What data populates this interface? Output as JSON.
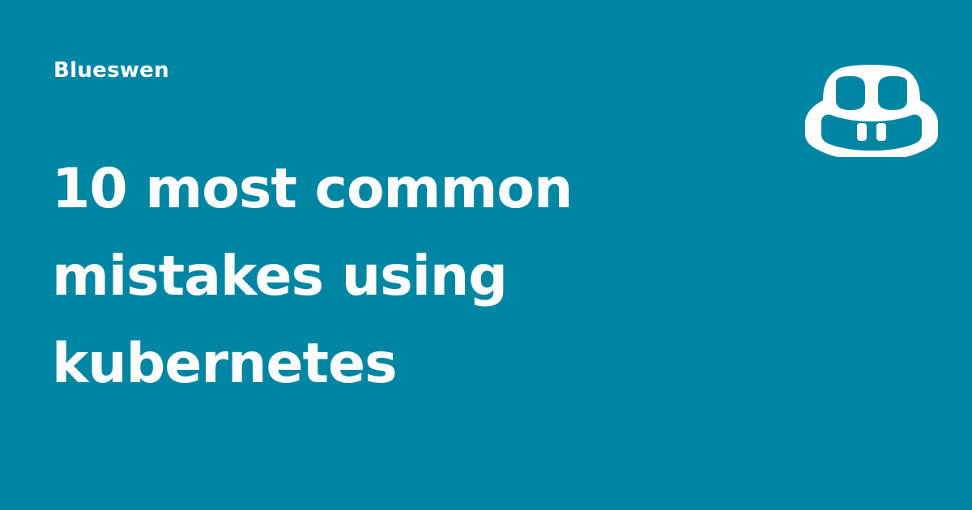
{
  "site": {
    "name": "Blueswen"
  },
  "article": {
    "title_lines": [
      "10 most common",
      "mistakes using",
      "kubernetes"
    ]
  },
  "logo": {
    "icon": "copilot-face-icon"
  },
  "colors": {
    "background": "#0086a2",
    "foreground": "#ffffff"
  }
}
